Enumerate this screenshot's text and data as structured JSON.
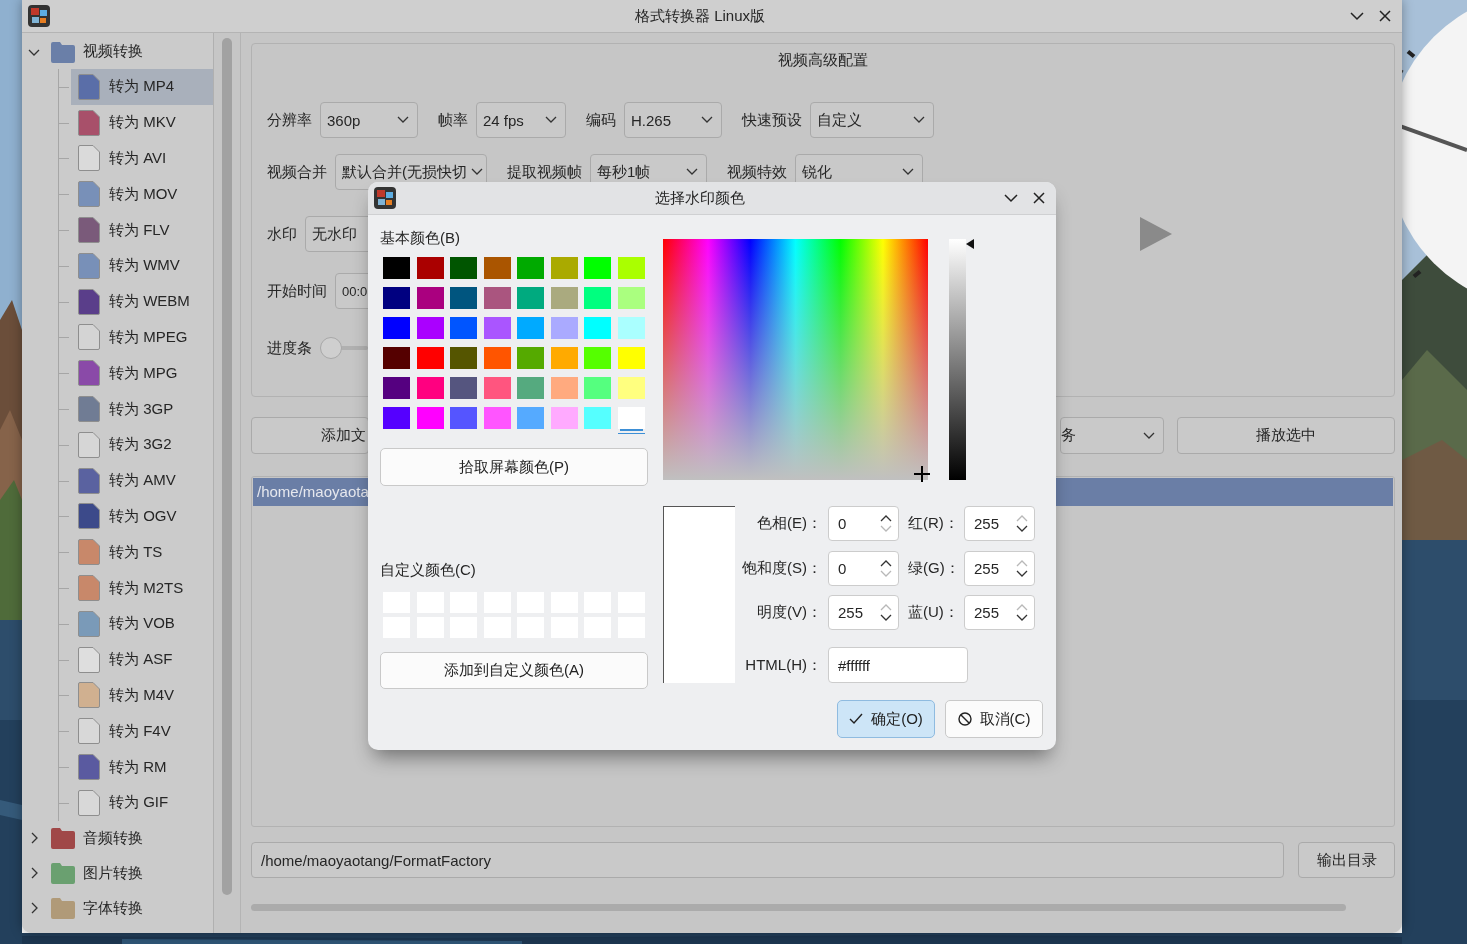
{
  "window": {
    "title": "格式转换器 Linux版"
  },
  "sidebar": {
    "categories": [
      {
        "label": "视频转换",
        "expanded": true,
        "color": "#6a7fa8",
        "children": [
          {
            "label": "转为 MP4",
            "selected": true,
            "color": "#5a6ea8"
          },
          {
            "label": "转为 MKV",
            "selected": false,
            "color": "#a8506a"
          },
          {
            "label": "转为 AVI",
            "selected": false,
            "color": "#dadada"
          },
          {
            "label": "转为 MOV",
            "selected": false,
            "color": "#7890b8"
          },
          {
            "label": "转为 FLV",
            "selected": false,
            "color": "#7a5a7a"
          },
          {
            "label": "转为 WMV",
            "selected": false,
            "color": "#7890b8"
          },
          {
            "label": "转为 WEBM",
            "selected": false,
            "color": "#5a3e8a"
          },
          {
            "label": "转为 MPEG",
            "selected": false,
            "color": "#d4d4d4"
          },
          {
            "label": "转为 MPG",
            "selected": false,
            "color": "#8a4aa8"
          },
          {
            "label": "转为 3GP",
            "selected": false,
            "color": "#707c94"
          },
          {
            "label": "转为 3G2",
            "selected": false,
            "color": "#d6d6d6"
          },
          {
            "label": "转为 AMV",
            "selected": false,
            "color": "#5a62a0"
          },
          {
            "label": "转为 OGV",
            "selected": false,
            "color": "#3c4a8a"
          },
          {
            "label": "转为 TS",
            "selected": false,
            "color": "#c8886a"
          },
          {
            "label": "转为 M2TS",
            "selected": false,
            "color": "#c8886a"
          },
          {
            "label": "转为 VOB",
            "selected": false,
            "color": "#7a9ab8"
          },
          {
            "label": "转为 ASF",
            "selected": false,
            "color": "#dedede"
          },
          {
            "label": "转为 M4V",
            "selected": false,
            "color": "#d0b090"
          },
          {
            "label": "转为 F4V",
            "selected": false,
            "color": "#d8d8d8"
          },
          {
            "label": "转为 RM",
            "selected": false,
            "color": "#5a5aa0"
          },
          {
            "label": "转为 GIF",
            "selected": false,
            "color": "#d8d8d8"
          }
        ]
      },
      {
        "label": "音频转换",
        "expanded": false,
        "color": "#a04848"
      },
      {
        "label": "图片转换",
        "expanded": false,
        "color": "#6aa070"
      },
      {
        "label": "字体转换",
        "expanded": false,
        "color": "#b09a78"
      }
    ]
  },
  "video_config": {
    "title": "视频高级配置",
    "row_1": [
      {
        "label": "分辨率",
        "value": "360p"
      },
      {
        "label": "帧率",
        "value": "24 fps"
      },
      {
        "label": "编码",
        "value": "H.265"
      },
      {
        "label": "快速预设",
        "value": "自定义"
      }
    ],
    "row_2": [
      {
        "label": "视频合并",
        "value": "默认合并(无损快切"
      },
      {
        "label": "提取视频帧",
        "value": "每秒1帧"
      },
      {
        "label": "视频特效",
        "value": "锐化"
      }
    ],
    "watermark": {
      "label": "水印",
      "value": "无水印"
    },
    "start_time": {
      "label": "开始时间",
      "value": "00:0"
    },
    "progress": {
      "label": "进度条",
      "level": 0
    }
  },
  "actions": {
    "add_button": "添加文",
    "task_dropdown": "务",
    "play_button": "播放选中"
  },
  "file_list": [
    {
      "path": "/home/maoyaota",
      "selected": true
    }
  ],
  "output": {
    "path": "/home/maoyaotang/FormatFactory",
    "button": "输出目录"
  },
  "dialog": {
    "title": "选择水印颜色",
    "basic_label": "基本颜色(B)",
    "basic_colors": [
      {
        "color": "#000000",
        "selected": false
      },
      {
        "color": "#aa0000",
        "selected": false
      },
      {
        "color": "#005500",
        "selected": false
      },
      {
        "color": "#aa5500",
        "selected": false
      },
      {
        "color": "#00aa00",
        "selected": false
      },
      {
        "color": "#aaaa00",
        "selected": false
      },
      {
        "color": "#00ff00",
        "selected": false
      },
      {
        "color": "#aaff00",
        "selected": false
      },
      {
        "color": "#000080",
        "selected": false
      },
      {
        "color": "#aa007f",
        "selected": false
      },
      {
        "color": "#00557f",
        "selected": false
      },
      {
        "color": "#aa557f",
        "selected": false
      },
      {
        "color": "#00aa7f",
        "selected": false
      },
      {
        "color": "#aaaa7f",
        "selected": false
      },
      {
        "color": "#00ff7f",
        "selected": false
      },
      {
        "color": "#aaff7f",
        "selected": false
      },
      {
        "color": "#0000ff",
        "selected": false
      },
      {
        "color": "#aa00ff",
        "selected": false
      },
      {
        "color": "#0055ff",
        "selected": false
      },
      {
        "color": "#aa55ff",
        "selected": false
      },
      {
        "color": "#00aaff",
        "selected": false
      },
      {
        "color": "#aaaaff",
        "selected": false
      },
      {
        "color": "#00ffff",
        "selected": false
      },
      {
        "color": "#aaffff",
        "selected": false
      },
      {
        "color": "#550000",
        "selected": false
      },
      {
        "color": "#ff0000",
        "selected": false
      },
      {
        "color": "#555500",
        "selected": false
      },
      {
        "color": "#ff5500",
        "selected": false
      },
      {
        "color": "#55aa00",
        "selected": false
      },
      {
        "color": "#ffaa00",
        "selected": false
      },
      {
        "color": "#55ff00",
        "selected": false
      },
      {
        "color": "#ffff00",
        "selected": false
      },
      {
        "color": "#550080",
        "selected": false
      },
      {
        "color": "#ff0080",
        "selected": false
      },
      {
        "color": "#55557f",
        "selected": false
      },
      {
        "color": "#ff557f",
        "selected": false
      },
      {
        "color": "#55aa7f",
        "selected": false
      },
      {
        "color": "#ffaa7f",
        "selected": false
      },
      {
        "color": "#55ff7f",
        "selected": false
      },
      {
        "color": "#ffff7f",
        "selected": false
      },
      {
        "color": "#5500ff",
        "selected": false
      },
      {
        "color": "#ff00ff",
        "selected": false
      },
      {
        "color": "#5555ff",
        "selected": false
      },
      {
        "color": "#ff55ff",
        "selected": false
      },
      {
        "color": "#55aaff",
        "selected": false
      },
      {
        "color": "#ffaaff",
        "selected": false
      },
      {
        "color": "#55ffff",
        "selected": false
      },
      {
        "color": "#ffffff",
        "selected": true
      }
    ],
    "pick_button": "拾取屏幕颜色(P)",
    "custom_label": "自定义颜色(C)",
    "custom_colors": [
      {
        "color": "#ffffff"
      },
      {
        "color": "#ffffff"
      },
      {
        "color": "#ffffff"
      },
      {
        "color": "#ffffff"
      },
      {
        "color": "#ffffff"
      },
      {
        "color": "#ffffff"
      },
      {
        "color": "#ffffff"
      },
      {
        "color": "#ffffff"
      },
      {
        "color": "#ffffff"
      },
      {
        "color": "#ffffff"
      },
      {
        "color": "#ffffff"
      },
      {
        "color": "#ffffff"
      },
      {
        "color": "#ffffff"
      },
      {
        "color": "#ffffff"
      },
      {
        "color": "#ffffff"
      },
      {
        "color": "#ffffff"
      }
    ],
    "add_custom_button": "添加到自定义颜色(A)",
    "value_bar": {
      "level": 1
    },
    "preview": {
      "color": "#ffffff"
    },
    "spin_fields": [
      {
        "label": "色相(E)：",
        "value": "0",
        "up_enabled": true,
        "down_enabled": false
      },
      {
        "label": "红(R)：",
        "value": "255",
        "up_enabled": false,
        "down_enabled": true
      },
      {
        "label": "饱和度(S)：",
        "value": "0",
        "up_enabled": true,
        "down_enabled": false
      },
      {
        "label": "绿(G)：",
        "value": "255",
        "up_enabled": false,
        "down_enabled": true
      },
      {
        "label": "明度(V)：",
        "value": "255",
        "up_enabled": false,
        "down_enabled": true
      },
      {
        "label": "蓝(U)：",
        "value": "255",
        "up_enabled": false,
        "down_enabled": true
      }
    ],
    "html_label": "HTML(H)：",
    "html_value": "#ffffff",
    "buttons": [
      {
        "label": "确定(O)",
        "kind": "ok",
        "default": true
      },
      {
        "label": "取消(C)",
        "kind": "cancel",
        "default": false
      }
    ]
  }
}
